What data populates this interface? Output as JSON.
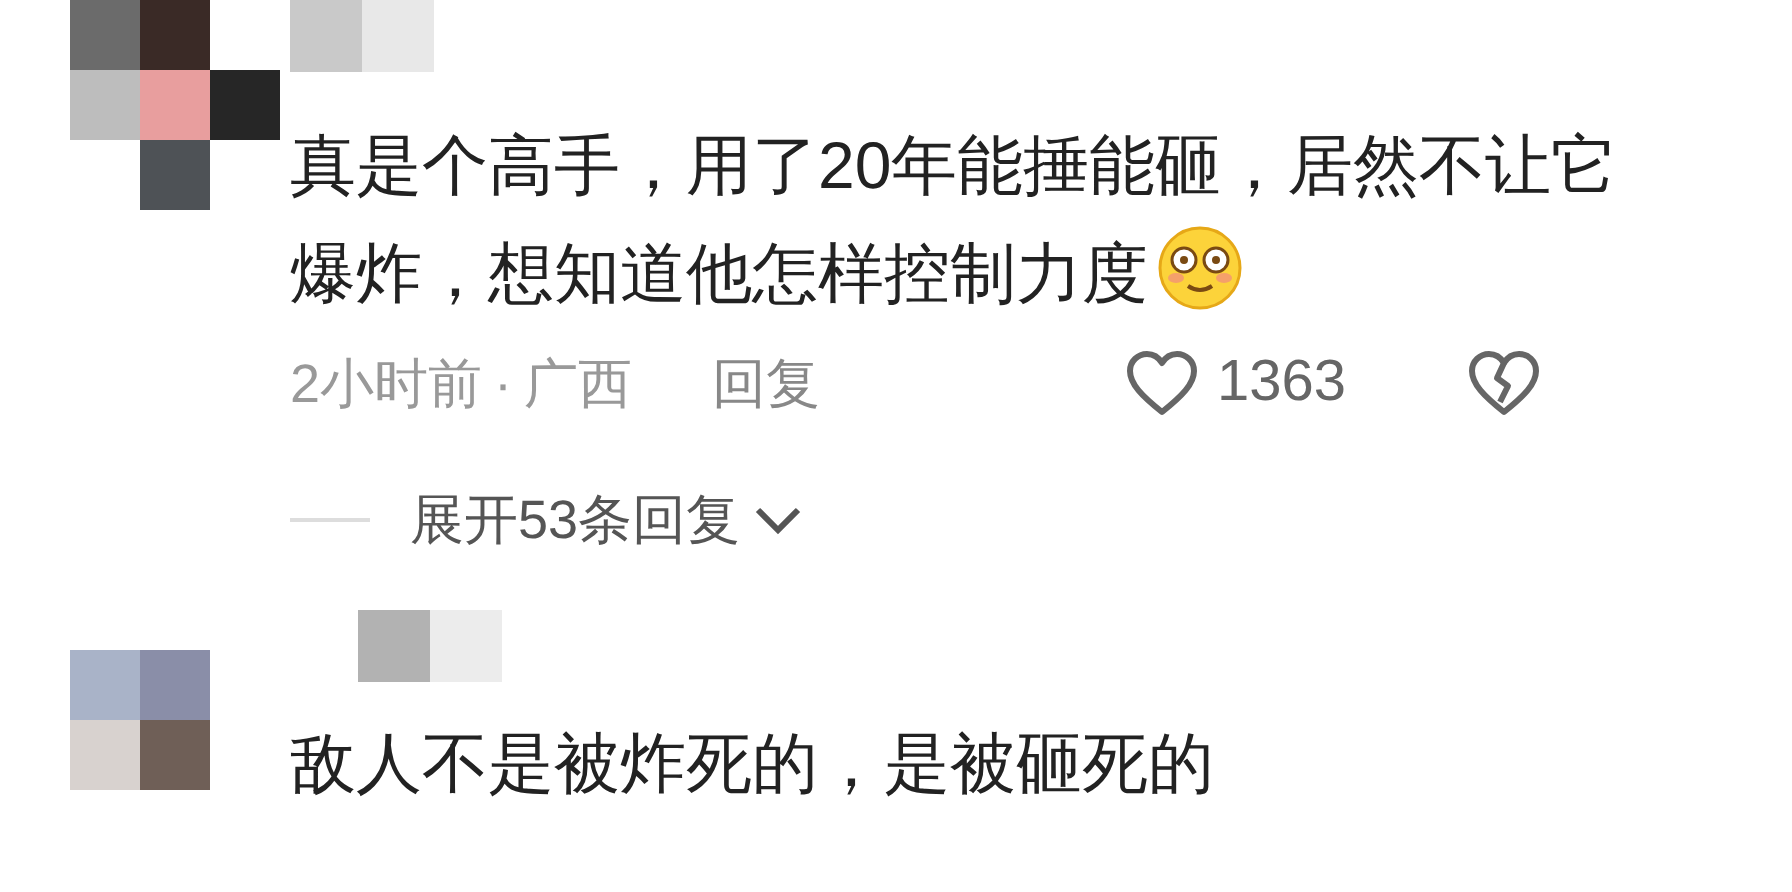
{
  "comments": [
    {
      "text": "真是个高手，用了20年能捶能砸，居然不让它爆炸，想知道他怎样控制力度",
      "emoji": true,
      "time": "2小时前",
      "separator": "·",
      "location": "广西",
      "reply_label": "回复",
      "likes": "1363",
      "liked": false,
      "expand_replies": "展开53条回复"
    },
    {
      "text": "敌人不是被炸死的，是被砸死的",
      "emoji": false
    }
  ]
}
